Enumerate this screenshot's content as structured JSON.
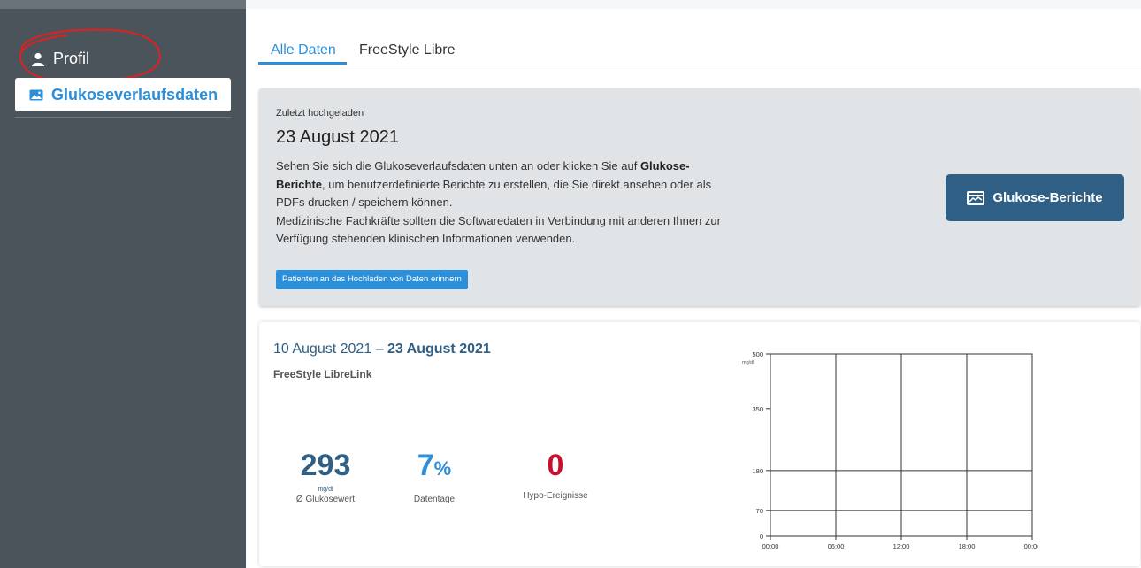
{
  "sidebar": {
    "profile_label": "Profil",
    "active_item_label": "Glukoseverlaufsdaten"
  },
  "tabs": [
    {
      "label": "Alle Daten",
      "active": true
    },
    {
      "label": "FreeStyle Libre",
      "active": false
    }
  ],
  "upload_card": {
    "small_label": "Zuletzt hochgeladen",
    "date": "23 August 2021",
    "text_1": "Sehen Sie sich die Glukoseverlaufsdaten unten an oder klicken Sie auf ",
    "text_bold": "Glukose-Berichte",
    "text_2": ", um benutzerdefinierte Berichte zu erstellen, die Sie direkt ansehen oder als PDFs drucken / speichern können.",
    "text_3": "Medizinische Fachkräfte sollten die Softwaredaten in Verbindung mit anderen Ihnen zur Verfügung stehenden klinischen Informationen verwenden.",
    "remind_button": "Patienten an das Hochladen von Daten erinnern",
    "reports_button": "Glukose-Berichte"
  },
  "data_card": {
    "range_start": "10 August 2021 – ",
    "range_end": "23 August 2021",
    "device": "FreeStyle LibreLink",
    "avg_glucose_value": "293",
    "avg_glucose_unit": "mg/dl",
    "avg_glucose_label": "Ø Glukosewert",
    "data_days_value": "7",
    "data_days_unit": "%",
    "data_days_label": "Datentage",
    "hypo_value": "0",
    "hypo_label": "Hypo-Ereignisse"
  },
  "chart_data": {
    "type": "line",
    "ylabel": "mg/dl",
    "y_ticks": [
      0,
      70,
      180,
      350,
      500
    ],
    "ylim": [
      0,
      500
    ],
    "x_ticks": [
      "00:00",
      "06:00",
      "12:00",
      "18:00",
      "00:00"
    ],
    "series": [],
    "reference_lines": [
      70,
      180
    ]
  },
  "colors": {
    "sidebar_bg": "#4b545b",
    "accent_blue": "#2b8fd9",
    "dark_blue": "#2f5f84",
    "hypo_red": "#c8102e",
    "card_gray": "#e1e4e7",
    "annotation_red": "#e02020"
  }
}
